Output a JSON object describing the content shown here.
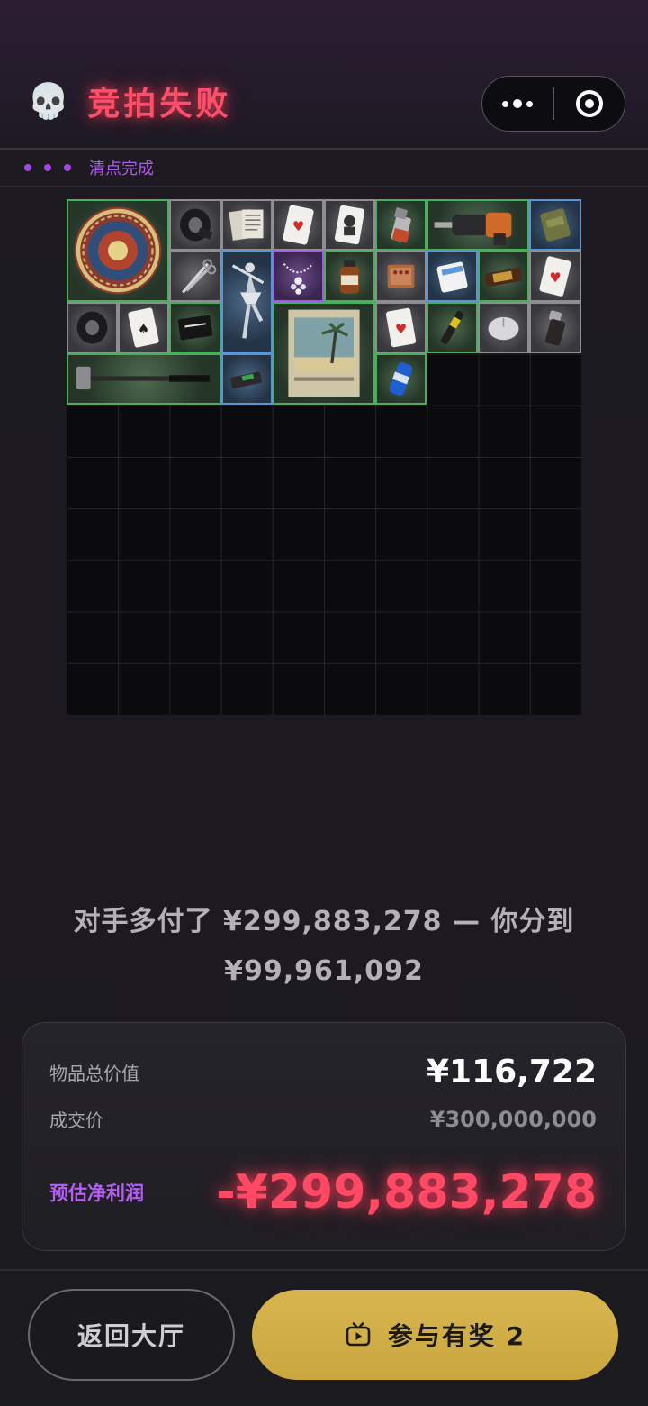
{
  "header": {
    "icon": "skull-icon",
    "title": "竞拍失败",
    "status_text": "清点完成",
    "menu_icon": "more-dots-icon",
    "close_icon": "target-close-icon"
  },
  "grid": {
    "columns": 10,
    "rows": 10,
    "items": [
      {
        "name": "ornate-plate",
        "rarity": "green"
      },
      {
        "name": "duct-tape",
        "rarity": "gray"
      },
      {
        "name": "paper-documents",
        "rarity": "gray"
      },
      {
        "name": "playing-card",
        "rarity": "gray"
      },
      {
        "name": "playing-card-portrait",
        "rarity": "gray"
      },
      {
        "name": "lighter",
        "rarity": "green"
      },
      {
        "name": "power-drill",
        "rarity": "green"
      },
      {
        "name": "ration-pack",
        "rarity": "blue"
      },
      {
        "name": "scissors",
        "rarity": "gray"
      },
      {
        "name": "ballerina-figurine",
        "rarity": "blue"
      },
      {
        "name": "necklace",
        "rarity": "purple"
      },
      {
        "name": "medicine-bottle",
        "rarity": "green"
      },
      {
        "name": "matchbox",
        "rarity": "gray"
      },
      {
        "name": "pill-box",
        "rarity": "blue"
      },
      {
        "name": "chocolate-bar",
        "rarity": "green"
      },
      {
        "name": "playing-card",
        "rarity": "gray"
      },
      {
        "name": "duct-tape",
        "rarity": "gray"
      },
      {
        "name": "playing-card-spades",
        "rarity": "gray"
      },
      {
        "name": "good-luck-card",
        "rarity": "green"
      },
      {
        "name": "vintage-poster",
        "rarity": "green"
      },
      {
        "name": "playing-card",
        "rarity": "gray"
      },
      {
        "name": "marker-pen",
        "rarity": "green"
      },
      {
        "name": "computer-mouse",
        "rarity": "gray"
      },
      {
        "name": "pepper-grinder",
        "rarity": "gray"
      },
      {
        "name": "sledgehammer",
        "rarity": "green"
      },
      {
        "name": "usb-drive",
        "rarity": "blue"
      },
      {
        "name": "energy-can",
        "rarity": "green"
      }
    ]
  },
  "message": {
    "line1": "对手多付了 ¥299,883,278 — 你分到",
    "line2": "¥99,961,092"
  },
  "summary": {
    "total_value_label": "物品总价值",
    "total_value": "¥116,722",
    "deal_price_label": "成交价",
    "deal_price": "¥300,000,000",
    "profit_label": "预估净利润",
    "profit_value": "-¥299,883,278"
  },
  "buttons": {
    "back_label": "返回大厅",
    "join_label": "参与有奖 2",
    "join_icon": "tv-play-icon"
  },
  "colors": {
    "accent_red": "#ff4f69",
    "accent_purple": "#b158f2",
    "gold": "#d4b04a",
    "rarity_green": "#4cae5a",
    "rarity_blue": "#5a95d6",
    "rarity_purple": "#a259e6",
    "rarity_gray": "#8d8d92"
  }
}
